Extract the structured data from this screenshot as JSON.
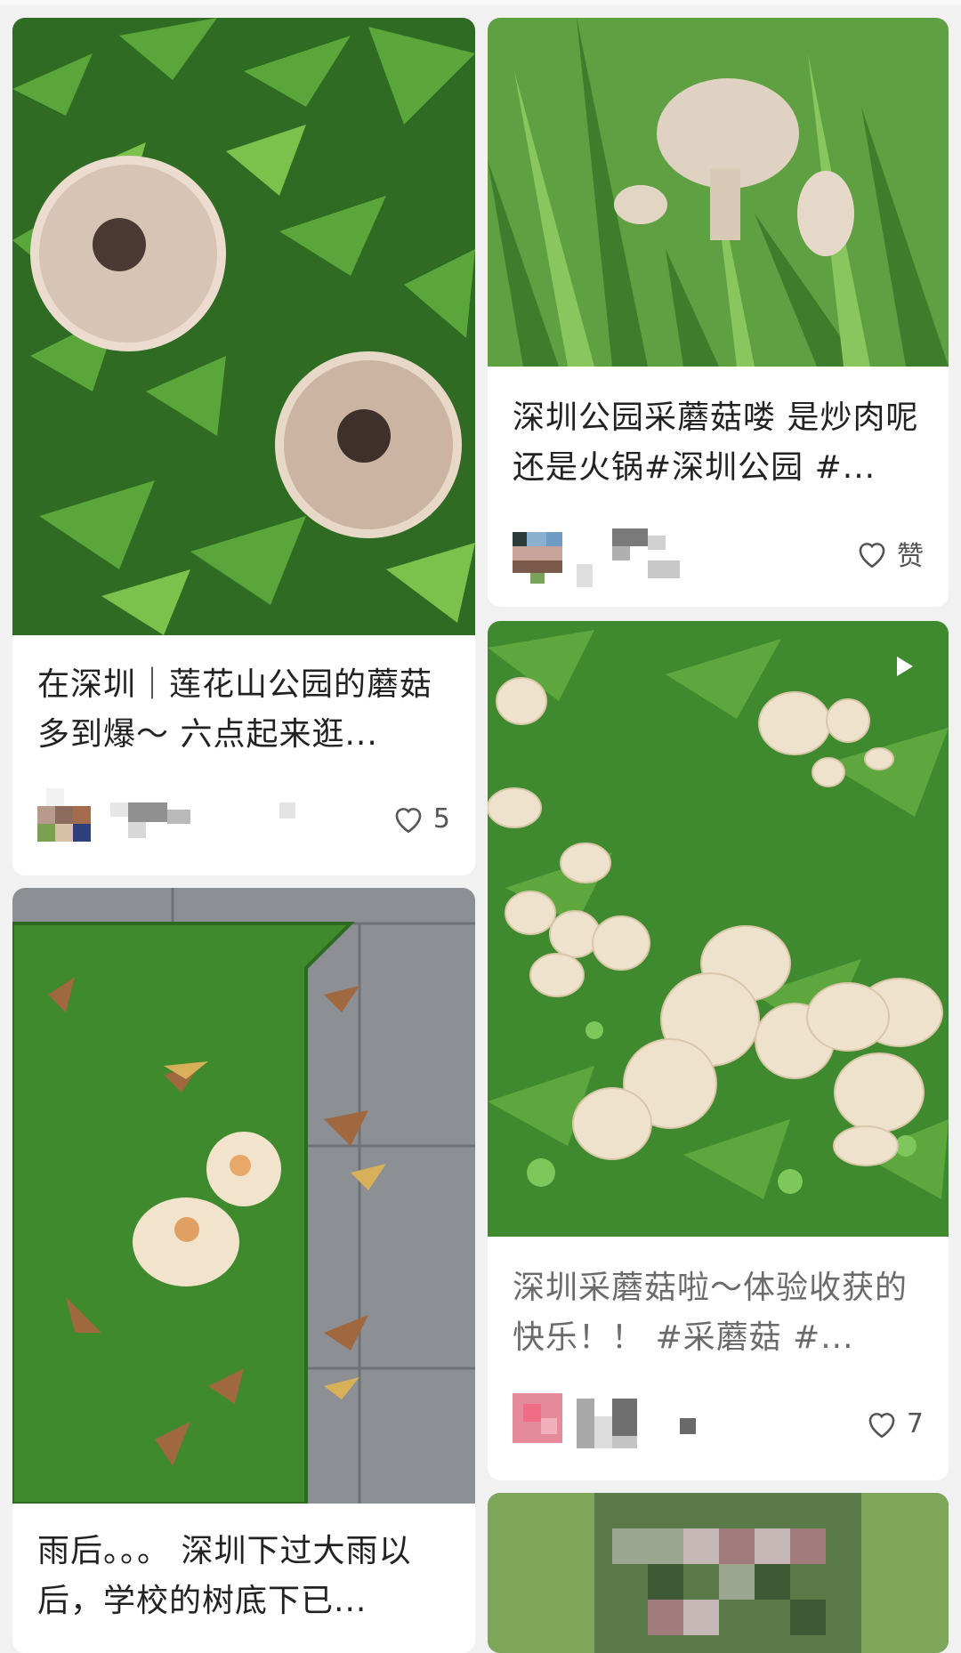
{
  "feed": {
    "cards": [
      {
        "id": "c1",
        "title": "在深圳｜莲花山公园的蘑菇多到爆～ 六点起来逛...",
        "likes": "5"
      },
      {
        "id": "c2",
        "title": "深圳公园采蘑菇喽 是炒肉呢还是火锅#深圳公园 #...",
        "likes": "赞"
      },
      {
        "id": "c3",
        "title": "深圳采蘑菇啦～体验收获的快乐！！ #采蘑菇 #...",
        "likes": "7"
      },
      {
        "id": "c4",
        "title": "雨后。。。 深圳下过大雨以后，学校的树底下已..."
      }
    ]
  },
  "colors": {
    "like_icon": "#555555",
    "grass": "#3f8a2e",
    "mushroom": "#efe2cc"
  },
  "icons": [
    "heart-icon",
    "play-icon"
  ]
}
